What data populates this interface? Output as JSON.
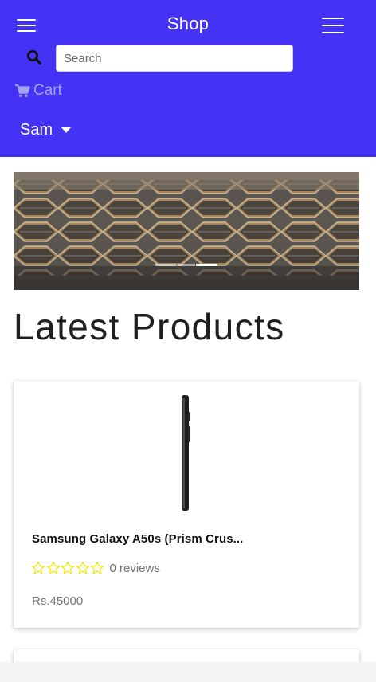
{
  "navbar": {
    "brand": "Shop",
    "left_toggle_icon": "hamburger-menu-icon",
    "right_toggle_icon": "hamburger-menu-icon",
    "background_color": "#4433f5"
  },
  "search": {
    "placeholder": "Search",
    "value": "",
    "icon": "search-icon"
  },
  "cart": {
    "label": "Cart",
    "icon": "shopping-cart-icon"
  },
  "user_menu": {
    "label": "Sam",
    "icon": "caret-down-icon"
  },
  "carousel": {
    "indicators": 3,
    "active_index": 2
  },
  "section_title": "Latest Products",
  "products": [
    {
      "name": "Samsung Galaxy A50s (Prism Crus...",
      "rating": 0,
      "max_rating": 5,
      "reviews": "0 reviews",
      "price": "Rs.45000",
      "image": "smartphone-side-view"
    }
  ],
  "colors": {
    "accent": "#4433f5",
    "star": "#f2e600",
    "muted_text": "#707070"
  }
}
